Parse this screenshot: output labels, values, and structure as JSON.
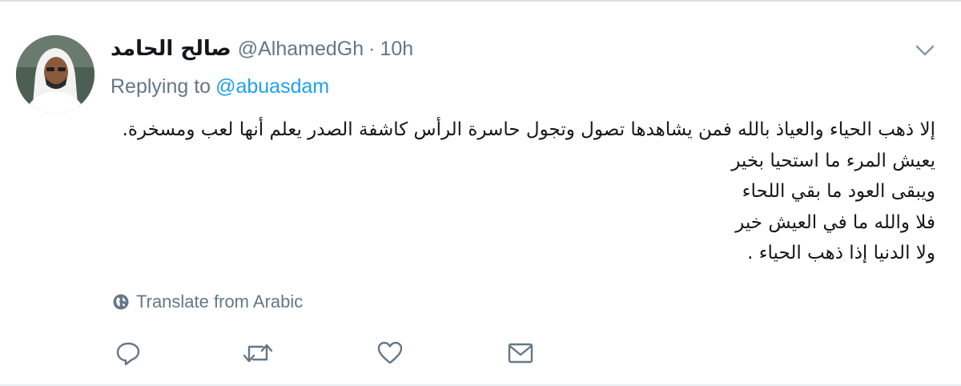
{
  "tweet": {
    "display_name": "صالح الحامد",
    "handle": "@AlhamedGh",
    "separator": "·",
    "time": "10h",
    "replying_label": "Replying to",
    "replying_to": "@abuasdam",
    "body_lines": [
      "إلا ذهب الحياء والعياذ بالله فمن يشاهدها تصول وتجول حاسرة الرأس كاشفة الصدر  يعلم أنها لعب ومسخرة.",
      "يعيش المرء ما استحيا بخير",
      "ويبقى العود ما بقي اللحاء",
      "فلا والله ما في العيش خير",
      "ولا الدنيا إذا ذهب الحياء ."
    ],
    "translate_label": "Translate from Arabic"
  },
  "icons": {
    "avatar": "avatar-photo",
    "caret": "chevron-down-icon",
    "globe": "globe-icon",
    "reply": "reply-icon",
    "retweet": "retweet-icon",
    "like": "heart-icon",
    "dm": "envelope-icon"
  },
  "colors": {
    "accent": "#1da1f2",
    "secondary_text": "#657786",
    "primary_text": "#14171a"
  }
}
